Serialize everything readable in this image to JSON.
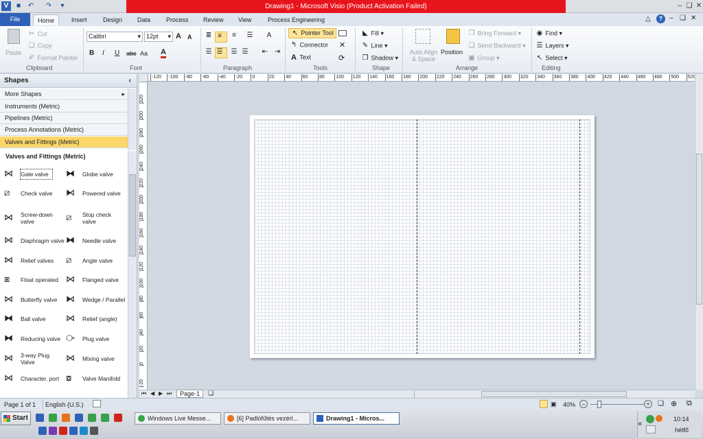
{
  "window": {
    "title": "Drawing1  -  Microsoft Visio (Product Activation Failed)"
  },
  "qat": {
    "save_icon": "save-icon",
    "undo_icon": "undo-icon",
    "redo_icon": "redo-icon"
  },
  "tabs": [
    "File",
    "Home",
    "Insert",
    "Design",
    "Data",
    "Process",
    "Review",
    "View",
    "Process Engineering"
  ],
  "ribbon": {
    "clipboard": {
      "label": "Clipboard",
      "paste": "Paste",
      "cut": "Cut",
      "copy": "Copy",
      "format_painter": "Format Painter"
    },
    "font": {
      "label": "Font",
      "family": "Calibri",
      "size": "12pt",
      "bold": "B",
      "italic": "I",
      "underline": "U",
      "strike": "abc",
      "case": "Aa",
      "grow": "A",
      "shrink": "A",
      "color": "A"
    },
    "paragraph": {
      "label": "Paragraph"
    },
    "tools": {
      "label": "Tools",
      "pointer": "Pointer Tool",
      "connector": "Connector",
      "text": "Text"
    },
    "shape": {
      "label": "Shape",
      "fill": "Fill",
      "line": "Line",
      "shadow": "Shadow"
    },
    "arrange": {
      "label": "Arrange",
      "auto_align": "Auto Align & Space",
      "position": "Position",
      "bring_forward": "Bring Forward",
      "send_backward": "Send Backward",
      "group": "Group"
    },
    "editing": {
      "label": "Editing",
      "find": "Find",
      "layers": "Layers",
      "select": "Select"
    }
  },
  "shapes_panel": {
    "title": "Shapes",
    "stencils": [
      "More Shapes",
      "Instruments (Metric)",
      "Pipelines (Metric)",
      "Process Annotations (Metric)",
      "Valves and Fittings (Metric)"
    ],
    "active_stencil": "Valves and Fittings (Metric)",
    "section_title": "Valves and Fittings (Metric)",
    "items": [
      "Gate valve",
      "Globe valve",
      "Check valve",
      "Powered valve",
      "Screw-down valve",
      "Stop check valve",
      "Diaphragm valve",
      "Needle valve",
      "Relief valves",
      "Angle valve",
      "Float operated",
      "Flanged valve",
      "Butterfly valve",
      "Wedge / Parallel",
      "Ball valve",
      "Relief  (angle)",
      "Reducing valve",
      "Plug valve",
      "3-way Plug Valve",
      "Mixing valve",
      "Character. port",
      "Valve Manifold"
    ]
  },
  "ruler": {
    "h_ticks": [
      "-120",
      "-100",
      "-80",
      "-60",
      "-40",
      "-20",
      "0",
      "20",
      "40",
      "60",
      "80",
      "100",
      "120",
      "140",
      "160",
      "180",
      "200",
      "220",
      "240",
      "260",
      "280",
      "300",
      "320",
      "340",
      "360",
      "380",
      "400",
      "420",
      "440",
      "460",
      "480",
      "500",
      "520"
    ],
    "v_ticks": [
      "320",
      "300",
      "280",
      "260",
      "240",
      "220",
      "200",
      "180",
      "160",
      "140",
      "120",
      "100",
      "80",
      "60",
      "40",
      "20",
      "0",
      "-20"
    ]
  },
  "page_tabs": {
    "current": "Page-1"
  },
  "status": {
    "page": "Page 1 of 1",
    "language": "English (U.S.)",
    "zoom": "40%"
  },
  "taskbar": {
    "start": "Start",
    "tasks": [
      "Windows Live Messe...",
      "[6] Padlófűtés vezérl...",
      "Drawing1 - Micros..."
    ],
    "time": "10:14",
    "day": "hétfő"
  }
}
